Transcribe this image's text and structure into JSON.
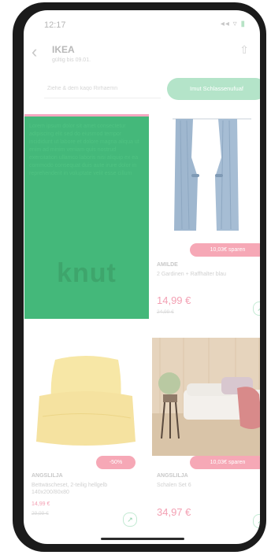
{
  "status_bar": {
    "time": "12:17",
    "icons": "◂◂ ▿",
    "battery": "▮"
  },
  "header": {
    "back_icon": "‹",
    "store_name": "IKEA",
    "store_subtitle": "gültig bis 09.01.",
    "share_icon": "⇧"
  },
  "search": {
    "placeholder": "Ziehe & dem kaqo Rirhaemn"
  },
  "cta": {
    "label": "Imut Schlassenufuaf"
  },
  "promo": {
    "text": "Lorem ipsum dolor sit amet consectetur adipiscing elit sed do eiusmod tempor incididunt ut labore et dolore magna aliqua ut enim ad minim veniam quis nostrud exercitation ullamco laboris nisi aliquip ex ea commodo consequat duis aute irure dolor in reprehenderit in voluptate velit esse cillum",
    "logo": "knut"
  },
  "colors": {
    "accent": "#44b87a",
    "price": "#f3a0b3",
    "badge": "#f6a8b6"
  },
  "products": [
    {
      "name": "AMILDE",
      "desc": "2 Gardinen + Raffhalter blau",
      "badge": "10,03€ sparen",
      "price": "14,99 €",
      "old_price": "24,99 €",
      "basket_icon": "↗"
    },
    {
      "name": "ANGSLILJA",
      "desc": "Bettwäscheset, 2-teilig hellgelb 140x200/80x80",
      "badge": "-50%",
      "price": "14,99 €",
      "old_price": "29,99 €",
      "basket_icon": "↗"
    },
    {
      "name": "ANGSLILJA",
      "desc": "Schalen Set 6",
      "badge": "10,03€ sparen",
      "price": "34,97 €",
      "old_price": "",
      "basket_icon": "↗"
    }
  ]
}
